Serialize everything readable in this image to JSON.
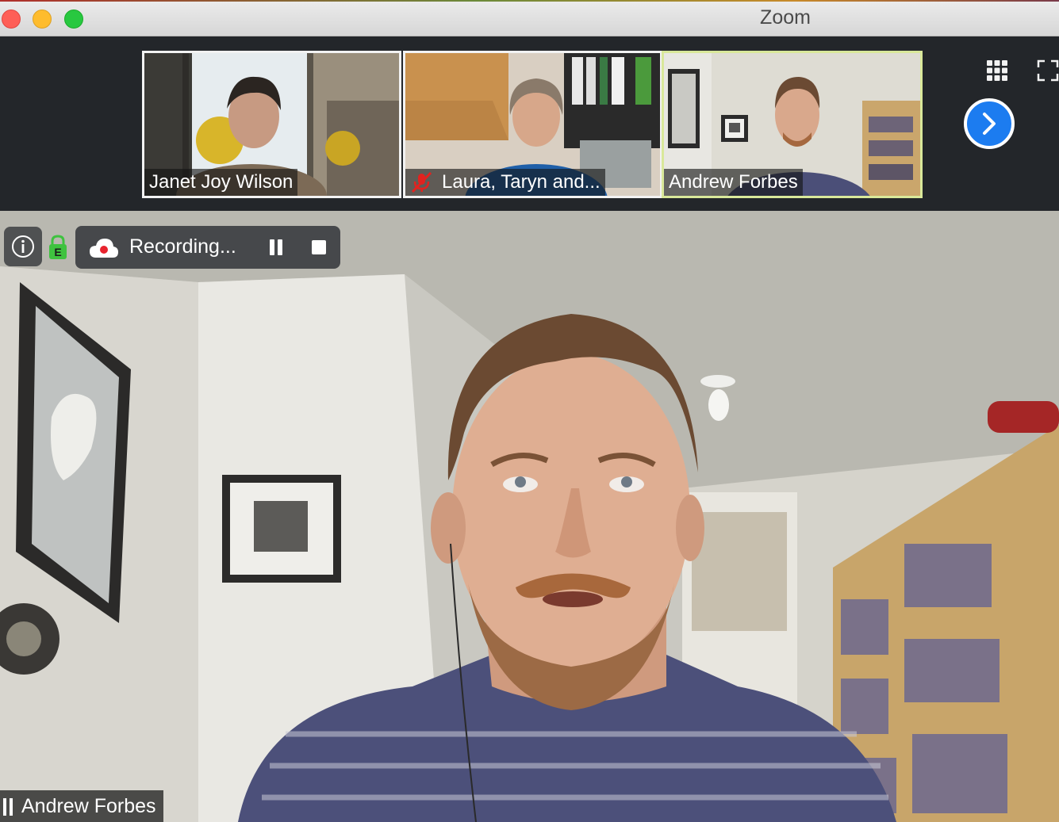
{
  "window": {
    "title": "Zoom"
  },
  "colors": {
    "active_speaker_border": "#d9e89a",
    "next_button": "#1c7cf0",
    "lock_green": "#3fc23f",
    "record_dot": "#e8232e"
  },
  "participants": [
    {
      "name": "Janet Joy Wilson",
      "muted": false,
      "active": false
    },
    {
      "name": "Laura, Taryn and...",
      "muted": true,
      "active": false
    },
    {
      "name": "Andrew Forbes",
      "muted": false,
      "active": true
    }
  ],
  "strip_controls": {
    "gallery_icon": "grid-icon",
    "fullscreen_icon": "fullscreen-icon",
    "next_icon": "chevron-right-icon"
  },
  "meeting": {
    "info_icon": "info-icon",
    "security_icon": "encryption-lock-icon",
    "recording": {
      "label": "Recording...",
      "icon": "cloud-record-icon",
      "pause_icon": "pause-icon",
      "stop_icon": "stop-icon"
    }
  },
  "main_video": {
    "speaker_name": "Andrew Forbes",
    "signal_icon": "audio-bars-icon"
  }
}
